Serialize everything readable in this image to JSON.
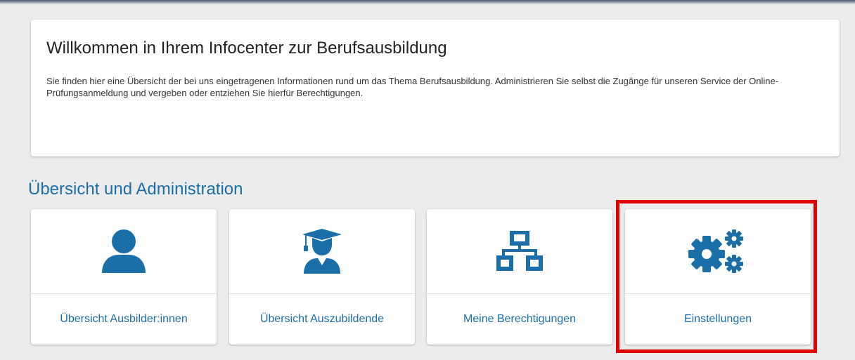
{
  "welcome": {
    "title": "Willkommen in Ihrem Infocenter zur Berufsausbildung",
    "text": "Sie finden hier eine Übersicht der bei uns eingetragenen Informationen rund um das Thema Berufsausbildung. Administrieren Sie selbst die Zugänge für unseren Service der Online-Prüfungsanmeldung und vergeben oder entziehen Sie hierfür Berechtigungen."
  },
  "section": {
    "title": "Übersicht und Administration"
  },
  "tiles": [
    {
      "label": "Übersicht Ausbilder:innen",
      "icon": "user-icon"
    },
    {
      "label": "Übersicht Auszubildende",
      "icon": "graduate-icon"
    },
    {
      "label": "Meine Berechtigungen",
      "icon": "network-icon"
    },
    {
      "label": "Einstellungen",
      "icon": "gears-icon",
      "highlighted": true
    }
  ],
  "colors": {
    "accent": "#1a6fa8",
    "highlight": "#e00000",
    "background": "#ececec",
    "card": "#ffffff"
  }
}
